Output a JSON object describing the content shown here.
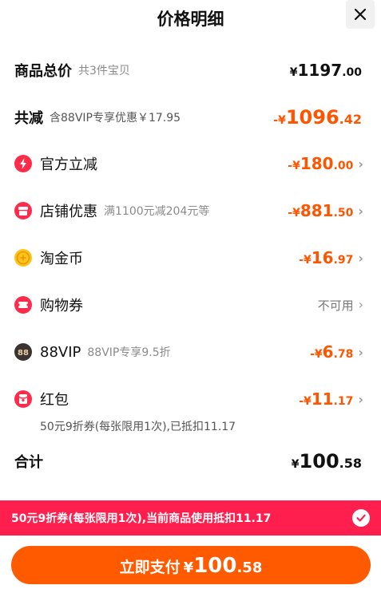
{
  "header": {
    "title": "价格明细",
    "close_label": "×"
  },
  "goods_total": {
    "label": "商品总价",
    "sub": "共3件宝贝",
    "symbol": "¥",
    "int": "1197",
    "dec": ".00"
  },
  "total_reduce": {
    "label": "共减",
    "sub": "含88VIP专享优惠￥17.95",
    "symbol": "-¥",
    "int": "1096",
    "dec": ".42"
  },
  "official": {
    "label": "官方立减",
    "symbol": "-¥",
    "int": "180",
    "dec": ".00"
  },
  "shop": {
    "label": "店铺优惠",
    "sub": "满1100元减204元等",
    "symbol": "-¥",
    "int": "881",
    "dec": ".50"
  },
  "coin": {
    "label": "淘金币",
    "symbol": "-¥",
    "int": "16",
    "dec": ".97"
  },
  "voucher": {
    "label": "购物券",
    "status": "不可用"
  },
  "vip": {
    "label": "88VIP",
    "sub": "88VIP专享9.5折",
    "symbol": "-¥",
    "int": "6",
    "dec": ".78",
    "icon_text": "88"
  },
  "redpacket": {
    "label": "红包",
    "symbol": "-¥",
    "int": "11",
    "dec": ".17",
    "note": "50元9折券(每张限用1次),已抵扣11.17"
  },
  "sum": {
    "label": "合计",
    "symbol": "¥",
    "int": "100",
    "dec": ".58"
  },
  "banner": {
    "text": "50元9折券(每张限用1次),当前商品使用抵扣11.17"
  },
  "pay": {
    "label": "立即支付",
    "symbol": "¥",
    "int": "100",
    "dec": ".58"
  },
  "colors": {
    "orange": "#ff5500",
    "banner_red": "#ff1f4e",
    "pay_orange": "#ff5a00",
    "icon_red": "#ff2b4a"
  },
  "icons": [
    "close-icon",
    "lightning-icon",
    "shop-icon",
    "coin-icon",
    "ticket-icon",
    "vip-icon",
    "red-packet-icon",
    "chevron-right-icon",
    "check-icon"
  ]
}
